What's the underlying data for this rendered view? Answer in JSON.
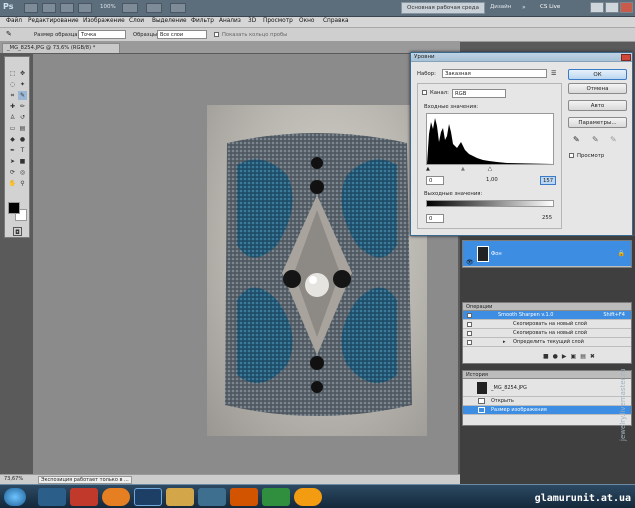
{
  "titlebar": {
    "zoom_display": "100%",
    "workspace_button": "Основная рабочая среда",
    "design_link": "Дизайн",
    "cslive_label": "CS Live"
  },
  "menu": [
    "Файл",
    "Редактирование",
    "Изображение",
    "Слои",
    "Выделение",
    "Фильтр",
    "Анализ",
    "3D",
    "Просмотр",
    "Окно",
    "Справка"
  ],
  "options": {
    "sample_size_label": "Размер образца:",
    "sample_size_value": "Точка",
    "samples_label": "Образцы:",
    "samples_value": "Все слои",
    "ring_label": "Показать кольцо пробы"
  },
  "document": {
    "tab_title": "_MG_8254.JPG @ 73,6% (RGB/8) *"
  },
  "status": {
    "zoom": "73,67%",
    "info": "Экспозиция работает только в ..."
  },
  "levels_dialog": {
    "title": "Уровни",
    "preset_label": "Набор:",
    "preset_value": "Заказная",
    "channel_label": "Канал:",
    "channel_value": "RGB",
    "input_label": "Входные значения:",
    "input_black": "0",
    "input_gamma": "1,00",
    "input_white": "157",
    "output_label": "Выходные значения:",
    "output_black": "0",
    "output_white": "255",
    "ok": "ОК",
    "cancel": "Отмена",
    "auto": "Авто",
    "options": "Параметры...",
    "preview": "Просмотр"
  },
  "layers_panel": {
    "layer_name": "Фон"
  },
  "actions_panel": {
    "tab": "Операции",
    "items": [
      {
        "label": "Smooth Sharpen v.1.0",
        "shortcut": "Shift+F4",
        "selected": true
      },
      {
        "label": "Скопировать на новый слой",
        "selected": false
      },
      {
        "label": "Скопировать на новый слой",
        "selected": false
      },
      {
        "label": "Определить текущий слой",
        "selected": false
      }
    ]
  },
  "history_panel": {
    "tab": "История",
    "snapshot": "_MG_8254.JPG",
    "items": [
      {
        "label": "Открыть",
        "selected": false
      },
      {
        "label": "Размер изображения",
        "selected": true
      }
    ]
  },
  "watermark": "glamurunit.at.ua",
  "side_watermark": "jewelry.livemaster.ru",
  "colors": {
    "accent": "#3d8de3",
    "titlebar": "#5c6d7c",
    "panel_bg": "#e4e4e4"
  }
}
